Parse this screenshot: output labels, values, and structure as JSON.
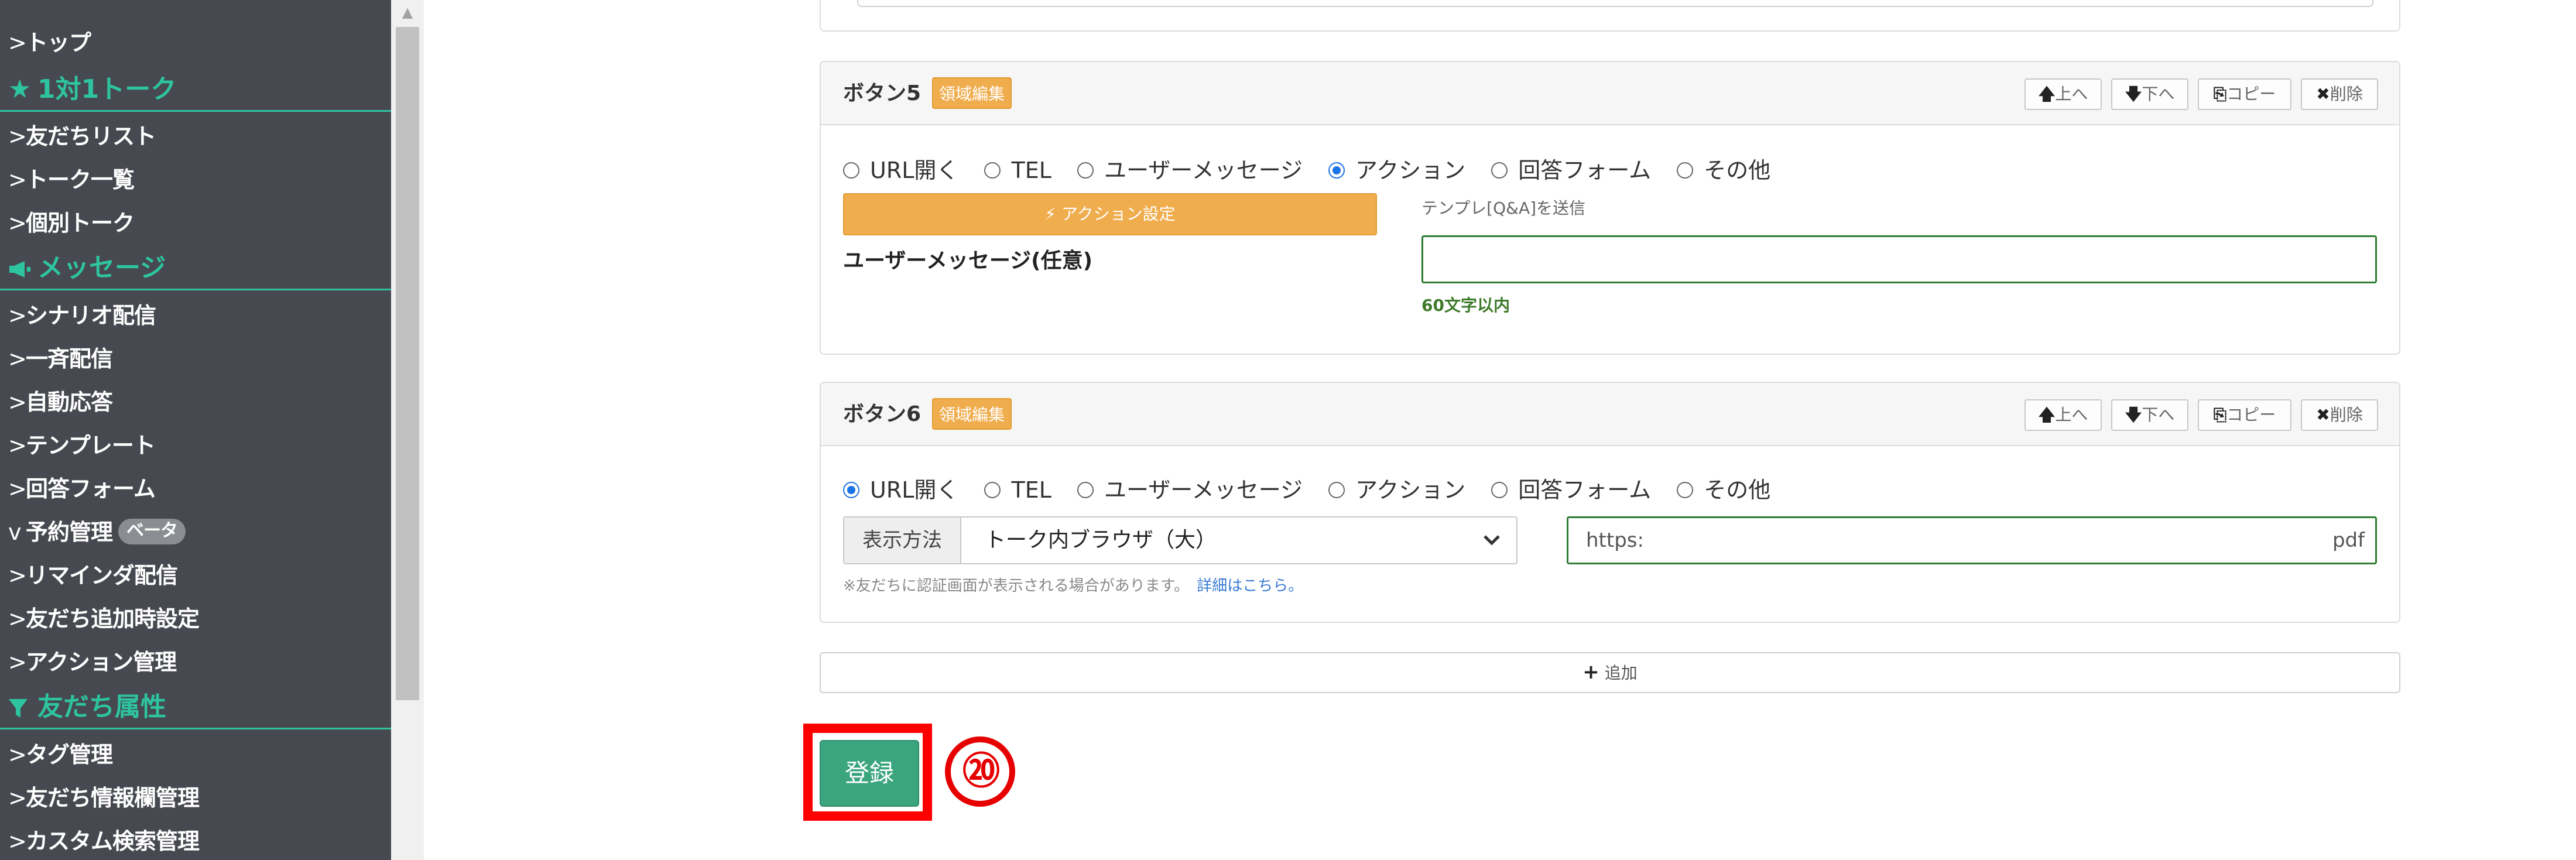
{
  "sidebar": {
    "items": [
      {
        "label": "トップ",
        "chevron": ">"
      },
      {
        "label": "友だちリスト",
        "chevron": ">"
      },
      {
        "label": "トーク一覧",
        "chevron": ">"
      },
      {
        "label": "個別トーク",
        "chevron": ">"
      },
      {
        "label": "シナリオ配信",
        "chevron": ">"
      },
      {
        "label": "一斉配信",
        "chevron": ">"
      },
      {
        "label": "自動応答",
        "chevron": ">"
      },
      {
        "label": "テンプレート",
        "chevron": ">"
      },
      {
        "label": "回答フォーム",
        "chevron": ">"
      },
      {
        "label": "予約管理",
        "chevron": "v",
        "badge": "ベータ"
      },
      {
        "label": "リマインダ配信",
        "chevron": ">"
      },
      {
        "label": "友だち追加時設定",
        "chevron": ">"
      },
      {
        "label": "アクション管理",
        "chevron": ">"
      },
      {
        "label": "タグ管理",
        "chevron": ">"
      },
      {
        "label": "友だち情報欄管理",
        "chevron": ">"
      },
      {
        "label": "カスタム検索管理",
        "chevron": ">"
      }
    ],
    "sections": [
      {
        "label": "1対1トーク",
        "icon": "star-icon"
      },
      {
        "label": "メッセージ",
        "icon": "megaphone-icon"
      },
      {
        "label": "友だち属性",
        "icon": "filter-icon"
      }
    ],
    "section_color": "#2ec4a0"
  },
  "button5": {
    "title": "ボタン5",
    "area_badge": "領域編集",
    "controls": {
      "up": "上へ",
      "down": "下へ",
      "copy": "コピー",
      "delete": "削除"
    },
    "options": [
      "URL開く",
      "TEL",
      "ユーザーメッセージ",
      "アクション",
      "回答フォーム",
      "その他"
    ],
    "selected": "アクション",
    "action_button": "アクション設定",
    "template_hint": "テンプレ[Q&A]を送信",
    "user_message_label": "ユーザーメッセージ(任意)",
    "user_message_value": "",
    "char_limit": "60文字以内"
  },
  "button6": {
    "title": "ボタン6",
    "area_badge": "領域編集",
    "controls": {
      "up": "上へ",
      "down": "下へ",
      "copy": "コピー",
      "delete": "削除"
    },
    "options": [
      "URL開く",
      "TEL",
      "ユーザーメッセージ",
      "アクション",
      "回答フォーム",
      "その他"
    ],
    "selected": "URL開く",
    "display_method_label": "表示方法",
    "display_method_value": "トーク内ブラウザ（大）",
    "url_value_start": "https:",
    "url_value_end": "pdf",
    "notice": "※友だちに認証画面が表示される場合があります。",
    "notice_link": "詳細はこちら。"
  },
  "add_button": {
    "label": "追加",
    "icon": "+"
  },
  "submit": {
    "label": "登録",
    "annotation": "⑳",
    "frame_color": "#ff0000"
  },
  "colors": {
    "accent_orange": "#f0ad4e",
    "submit_green": "#3aa57e",
    "input_border": "#2e7d32",
    "annotation_red": "#e60000"
  }
}
